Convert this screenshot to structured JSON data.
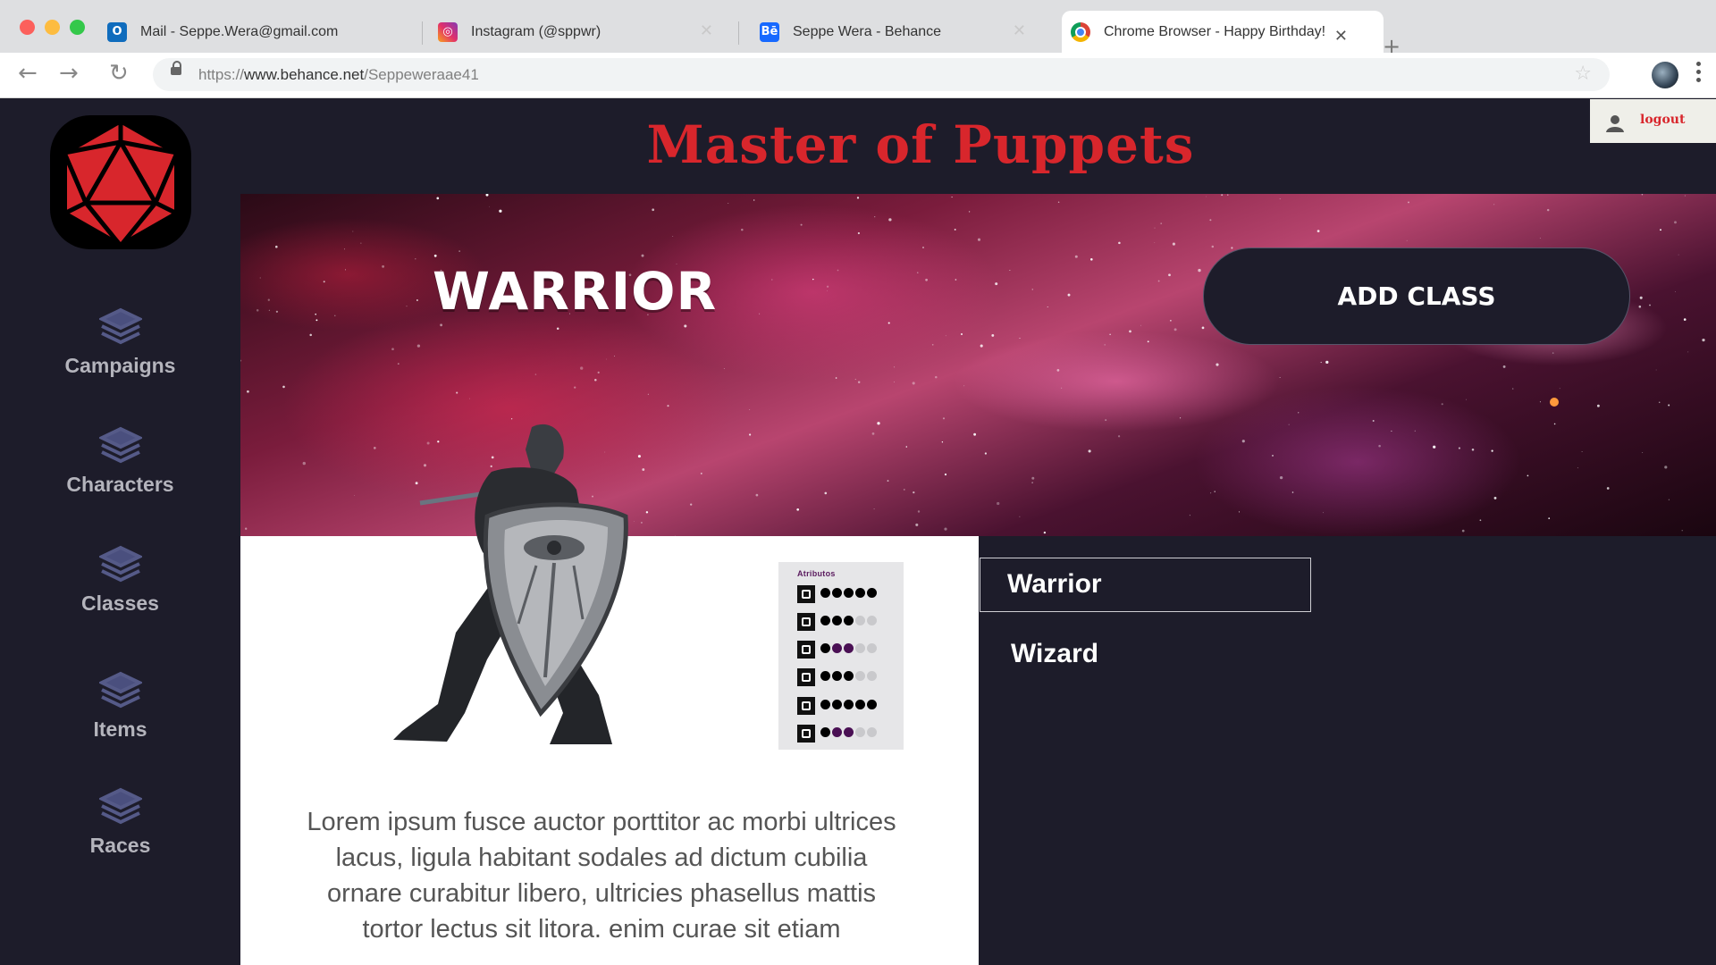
{
  "browser": {
    "tabs": [
      {
        "title": "Mail - Seppe.Wera@gmail.com",
        "icon": "outlook-icon"
      },
      {
        "title": "Instagram (@sppwr)",
        "icon": "instagram-icon"
      },
      {
        "title": "Seppe Wera - Behance",
        "icon": "behance-icon"
      },
      {
        "title": "Chrome Browser - Happy Birthday!",
        "icon": "chrome-icon"
      }
    ],
    "url_prefix": "https://",
    "url_domain": "www.behance.net",
    "url_path": "/Seppeweraae41",
    "behance_glyph": "Bē"
  },
  "app": {
    "title": "Master of Puppets",
    "logout_label": "logout",
    "nav": [
      "Campaigns",
      "Characters",
      "Classes",
      "Items",
      "Races"
    ],
    "class_heading": "WARRIOR",
    "add_class_label": "ADD CLASS",
    "attributes": {
      "heading": "Atributos",
      "rows": [
        {
          "icon": "attribute-icon-1",
          "filled": 5,
          "purple": 0
        },
        {
          "icon": "attribute-icon-2",
          "filled": 3,
          "purple": 0
        },
        {
          "icon": "attribute-icon-3",
          "filled": 1,
          "purple": 2
        },
        {
          "icon": "attribute-icon-4",
          "filled": 3,
          "purple": 0
        },
        {
          "icon": "attribute-icon-5",
          "filled": 5,
          "purple": 0
        },
        {
          "icon": "attribute-icon-6",
          "filled": 1,
          "purple": 2
        }
      ]
    },
    "description": "Lorem ipsum fusce auctor porttitor ac morbi ultrices lacus, ligula habitant sodales ad dictum cubilia ornare curabitur libero, ultricies phasellus mattis tortor lectus sit litora. enim curae sit etiam",
    "classes": [
      "Warrior",
      "Wizard"
    ],
    "selected_class": "Warrior",
    "colors": {
      "accent": "#d8262c",
      "bg": "#1d1c2a",
      "purple": "#4a1054"
    }
  }
}
